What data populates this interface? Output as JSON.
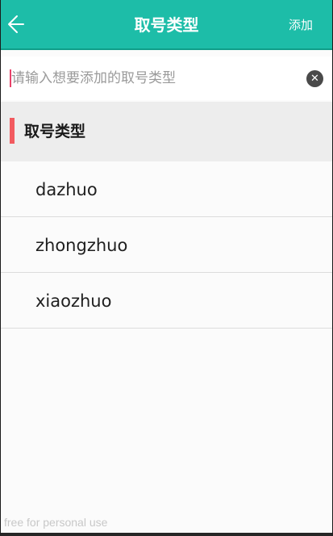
{
  "header": {
    "title": "取号类型",
    "add_label": "添加",
    "back_icon": "arrow-left-icon",
    "background": "#1dbda8"
  },
  "search": {
    "placeholder": "请输入想要添加的取号类型",
    "value": "",
    "clear_icon": "clear-icon",
    "clear_glyph": "✕"
  },
  "section": {
    "title": "取号类型",
    "accent_color": "#f25a5f"
  },
  "types": [
    {
      "label": "dazhuo"
    },
    {
      "label": "zhongzhuo"
    },
    {
      "label": "xiaozhuo"
    }
  ],
  "watermark": "free for personal use"
}
